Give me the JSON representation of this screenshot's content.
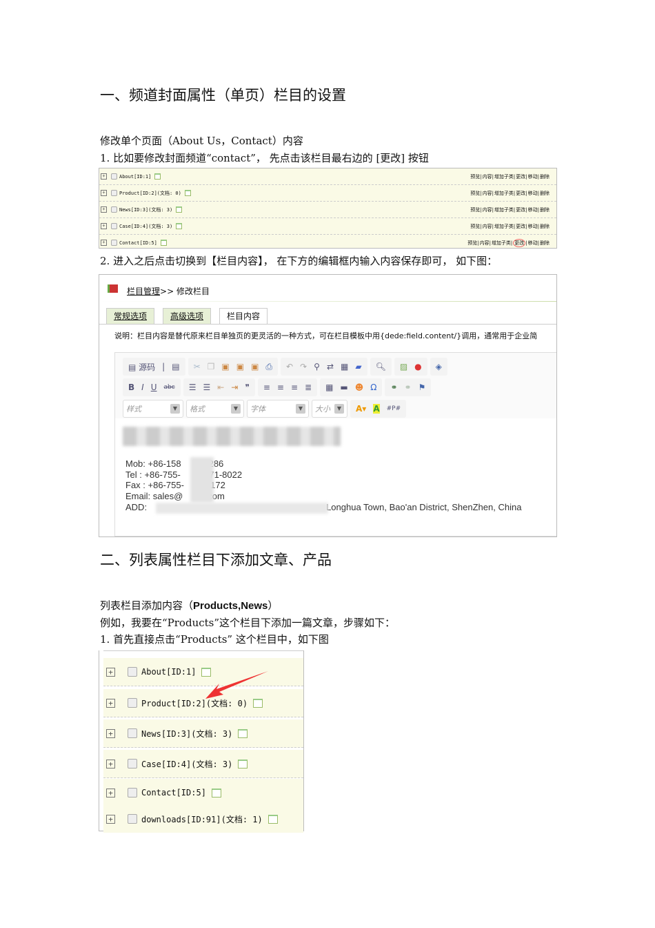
{
  "section1": {
    "title": "一、频道封面属性（单页）栏目的设置",
    "intro": "修改单个页面（About Us，Contact）内容",
    "step1": "1. 比如要修改封面频道“contact”， 先点击该栏目最右边的 [更改] 按钮",
    "step2": "2. 进入之后点击切换到【栏目内容】， 在下方的编辑框内输入内容保存即可， 如下图："
  },
  "table1": {
    "rows": [
      "About[ID:1]",
      "Product[ID:2](文档: 0)",
      "News[ID:3](文档: 3)",
      "Case[ID:4](文档: 3)",
      "Contact[ID:5]"
    ],
    "actions": [
      "预览",
      "内容",
      "增加子类",
      "更改",
      "移动",
      "删除"
    ]
  },
  "editor": {
    "breadcrumb_link": "栏目管理",
    "breadcrumb_sep": ">>",
    "breadcrumb_current": "修改栏目",
    "tabs": [
      "常规选项",
      "高级选项",
      "栏目内容"
    ],
    "note": "说明：栏目内容是替代原来栏目单独页的更灵活的一种方式，可在栏目模板中用{dede:field.content/}调用，通常用于企业简",
    "source_label": "源码",
    "selects": [
      "样式",
      "格式",
      "字体",
      "大小"
    ],
    "contact": {
      "mob": "Mob: +86-158",
      "mob_end": "286",
      "tel": "Tel  :  +86-755-",
      "tel_end": "1171-8022",
      "fax": "Fax :  +86-755-",
      "fax_end": "1172",
      "email": "Email:  sales@",
      "email_end": "com",
      "add": "ADD:",
      "add_end": "Longhua Town, Bao'an District, ShenZhen, China"
    }
  },
  "section2": {
    "title": "二、列表属性栏目下添加文章、产品",
    "intro_pre": "列表栏目添加内容（",
    "intro_bold": "Products,News",
    "intro_post": "）",
    "example": "例如，我要在“Products”这个栏目下添加一篇文章，步骤如下：",
    "step1": "1. 首先直接点击“Products” 这个栏目中，如下图"
  },
  "table2": {
    "rows": [
      "About[ID:1]",
      "Product[ID:2](文档: 0)",
      "News[ID:3](文档: 3)",
      "Case[ID:4](文档: 3)",
      "Contact[ID:5]",
      "downloads[ID:91](文档: 1)"
    ]
  },
  "colors": {
    "row_bg": "#fafae6",
    "arrow": "#e33"
  }
}
